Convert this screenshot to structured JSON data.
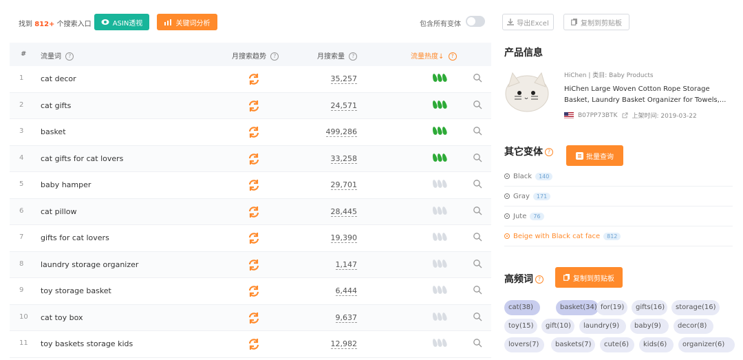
{
  "toolbar": {
    "found_prefix": "找到",
    "found_count": "812+",
    "found_suffix": "个搜索入口",
    "asin_button": "ASIN透视",
    "keyword_button": "关键词分析",
    "toggle_label": "包含所有变体",
    "export_excel": "导出Excel",
    "copy_clipboard": "复制到剪贴板"
  },
  "table": {
    "headers": {
      "index": "#",
      "keyword": "流量词",
      "trend": "月搜索趋势",
      "volume": "月搜索量",
      "heat": "流量热度↓"
    },
    "rows": [
      {
        "idx": "1",
        "keyword": "cat decor",
        "volume": "35,257",
        "heat": 3
      },
      {
        "idx": "2",
        "keyword": "cat gifts",
        "volume": "24,571",
        "heat": 3
      },
      {
        "idx": "3",
        "keyword": "basket",
        "volume": "499,286",
        "heat": 3
      },
      {
        "idx": "4",
        "keyword": "cat gifts for cat lovers",
        "volume": "33,258",
        "heat": 3
      },
      {
        "idx": "5",
        "keyword": "baby hamper",
        "volume": "29,701",
        "heat": 0
      },
      {
        "idx": "6",
        "keyword": "cat pillow",
        "volume": "28,445",
        "heat": 0
      },
      {
        "idx": "7",
        "keyword": "gifts for cat lovers",
        "volume": "19,390",
        "heat": 0
      },
      {
        "idx": "8",
        "keyword": "laundry storage organizer",
        "volume": "1,147",
        "heat": 0
      },
      {
        "idx": "9",
        "keyword": "toy storage basket",
        "volume": "6,444",
        "heat": 0
      },
      {
        "idx": "10",
        "keyword": "cat toy box",
        "volume": "9,637",
        "heat": 0
      },
      {
        "idx": "11",
        "keyword": "toy baskets storage kids",
        "volume": "12,982",
        "heat": 0
      }
    ]
  },
  "product": {
    "section_title": "产品信息",
    "brand": "HiChen",
    "category": "类目: Baby Products",
    "title": "HiChen Large Woven Cotton Rope Storage Basket, Laundry Basket Organizer for Towels,...",
    "asin": "B07PP73BTK",
    "launch": "上架时间: 2019-03-22"
  },
  "variants": {
    "section_title": "其它变体",
    "batch_button": "批量查询",
    "items": [
      {
        "name": "Black",
        "count": "140"
      },
      {
        "name": "Gray",
        "count": "171"
      },
      {
        "name": "Jute",
        "count": "76"
      },
      {
        "name": "Beige with Black cat face",
        "count": "812"
      }
    ]
  },
  "frequent": {
    "section_title": "高频词",
    "copy_button": "复制到剪贴板",
    "tags": [
      "cat(38)",
      "basket(34)",
      "for(19)",
      "gifts(16)",
      "storage(16)",
      "toy(15)",
      "gift(10)",
      "laundry(9)",
      "baby(9)",
      "decor(8)",
      "lovers(7)",
      "baskets(7)",
      "cute(6)",
      "kids(6)",
      "organizer(6)"
    ]
  },
  "colors": {
    "accent": "#ff8a2b",
    "teal": "#19b59a",
    "leaf_on": "#2daa37",
    "leaf_off": "#d9dde3"
  }
}
